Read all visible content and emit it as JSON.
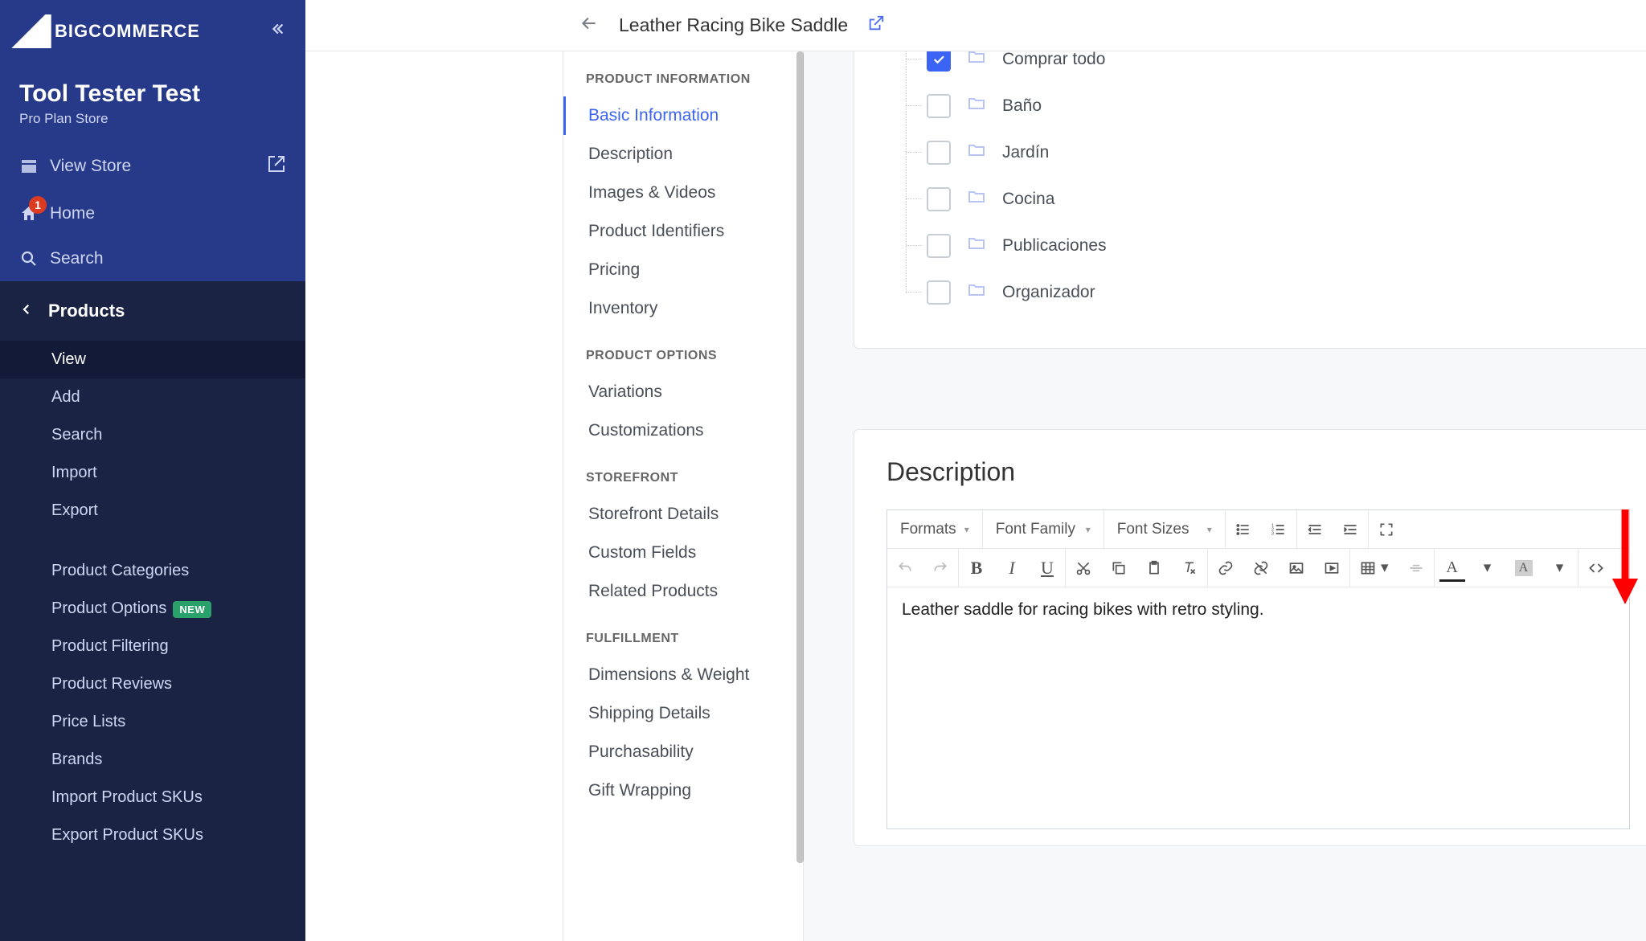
{
  "brand": {
    "name": "BIGCOMMERCE"
  },
  "store": {
    "name": "Tool Tester Test",
    "plan": "Pro Plan Store"
  },
  "sidebar": {
    "view_store": "View Store",
    "home": "Home",
    "home_badge": "1",
    "search": "Search",
    "back_label": "Products",
    "back_icon": "chevron-left-icon",
    "items": [
      {
        "label": "View",
        "active": true
      },
      {
        "label": "Add"
      },
      {
        "label": "Search"
      },
      {
        "label": "Import"
      },
      {
        "label": "Export"
      },
      {
        "label": "Product Categories",
        "group_break": true
      },
      {
        "label": "Product Options",
        "badge": "NEW"
      },
      {
        "label": "Product Filtering"
      },
      {
        "label": "Product Reviews"
      },
      {
        "label": "Price Lists"
      },
      {
        "label": "Brands"
      },
      {
        "label": "Import Product SKUs"
      },
      {
        "label": "Export Product SKUs"
      }
    ]
  },
  "topbar": {
    "title": "Leather Racing Bike Saddle"
  },
  "product_nav": {
    "groups": [
      {
        "title": "PRODUCT INFORMATION",
        "items": [
          "Basic Information",
          "Description",
          "Images & Videos",
          "Product Identifiers",
          "Pricing",
          "Inventory"
        ],
        "active_index": 0
      },
      {
        "title": "PRODUCT OPTIONS",
        "items": [
          "Variations",
          "Customizations"
        ]
      },
      {
        "title": "STOREFRONT",
        "items": [
          "Storefront Details",
          "Custom Fields",
          "Related Products"
        ]
      },
      {
        "title": "FULFILLMENT",
        "items": [
          "Dimensions & Weight",
          "Shipping Details",
          "Purchasability",
          "Gift Wrapping"
        ]
      }
    ]
  },
  "categories": [
    {
      "label": "Comprar todo",
      "checked": true
    },
    {
      "label": "Baño",
      "checked": false
    },
    {
      "label": "Jardín",
      "checked": false
    },
    {
      "label": "Cocina",
      "checked": false
    },
    {
      "label": "Publicaciones",
      "checked": false
    },
    {
      "label": "Organizador",
      "checked": false
    }
  ],
  "description": {
    "heading": "Description",
    "toolbar": {
      "formats": "Formats",
      "font_family": "Font Family",
      "font_sizes": "Font Sizes"
    },
    "body": "Leather saddle for racing bikes with retro styling."
  },
  "annotation": {
    "arrow_target": "source-code-button"
  }
}
